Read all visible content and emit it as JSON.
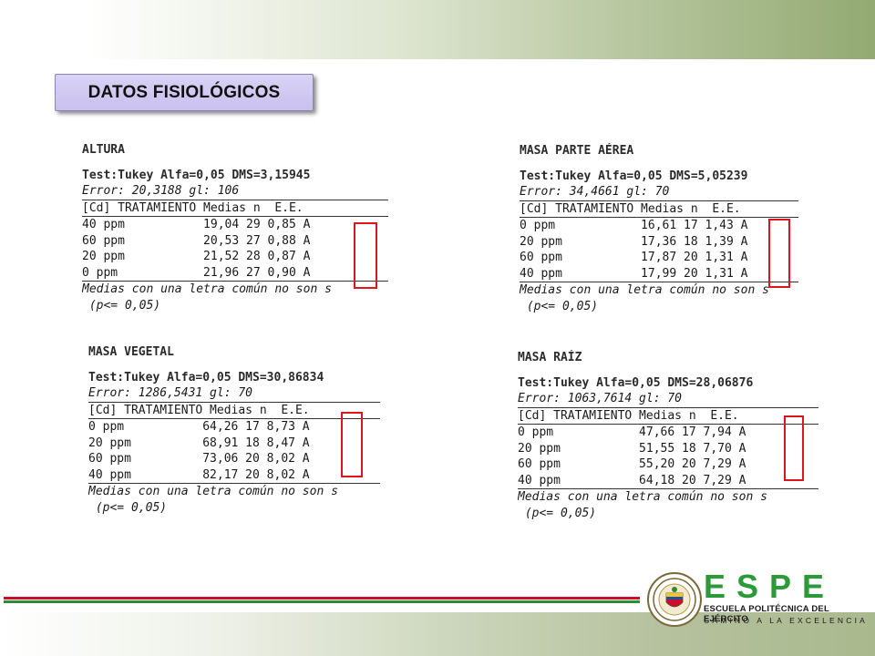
{
  "title": "DATOS FISIOLÓGICOS",
  "panels": [
    {
      "heading": "ALTURA",
      "test": "Test:Tukey Alfa=0,05 DMS=3,15945",
      "error": "Error: 20,3188 gl: 106",
      "header": "[Cd] TRATAMIENTO Medias n  E.E.",
      "rows": [
        "40 ppm           19,04 29 0,85 A",
        "60 ppm           20,53 27 0,88 A",
        "20 ppm           21,52 28 0,87 A",
        "0 ppm            21,96 27 0,90 A"
      ],
      "footer1": "Medias con una letra común no son s",
      "footer2": " (p<= 0,05)"
    },
    {
      "heading": "MASA PARTE AÉREA",
      "test": "Test:Tukey Alfa=0,05 DMS=5,05239",
      "error": "Error: 34,4661 gl: 70",
      "header": "[Cd] TRATAMIENTO Medias n  E.E.",
      "rows": [
        "0 ppm            16,61 17 1,43 A",
        "20 ppm           17,36 18 1,39 A",
        "60 ppm           17,87 20 1,31 A",
        "40 ppm           17,99 20 1,31 A"
      ],
      "footer1": "Medias con una letra común no son s",
      "footer2": " (p<= 0,05)"
    },
    {
      "heading": "MASA VEGETAL",
      "test": "Test:Tukey Alfa=0,05 DMS=30,86834",
      "error": "Error: 1286,5431 gl: 70",
      "header": "[Cd] TRATAMIENTO Medias n  E.E.",
      "rows": [
        "0 ppm           64,26 17 8,73 A",
        "20 ppm          68,91 18 8,47 A",
        "60 ppm          73,06 20 8,02 A",
        "40 ppm          82,17 20 8,02 A"
      ],
      "footer1": "Medias con una letra común no son s",
      "footer2": " (p<= 0,05)"
    },
    {
      "heading": "MASA RAÍZ",
      "test": "Test:Tukey Alfa=0,05 DMS=28,06876",
      "error": "Error: 1063,7614 gl: 70",
      "header": "[Cd] TRATAMIENTO Medias n  E.E.",
      "rows": [
        "0 ppm            47,66 17 7,94 A",
        "20 ppm           51,55 18 7,70 A",
        "60 ppm           55,20 20 7,29 A",
        "40 ppm           64,18 20 7,29 A"
      ],
      "footer1": "Medias con una letra común no son s",
      "footer2": " (p<= 0,05)"
    }
  ],
  "logo": {
    "letters": "ESPE",
    "line1": "ESCUELA POLITÉCNICA DEL EJÉRCITO",
    "line2": "CAMINO A LA EXCELENCIA"
  },
  "colors": {
    "highlight_box": "#e0141c",
    "logo_green": "#2d9a3a",
    "stripe_red": "#c8102e",
    "stripe_green": "#2e8b34"
  }
}
